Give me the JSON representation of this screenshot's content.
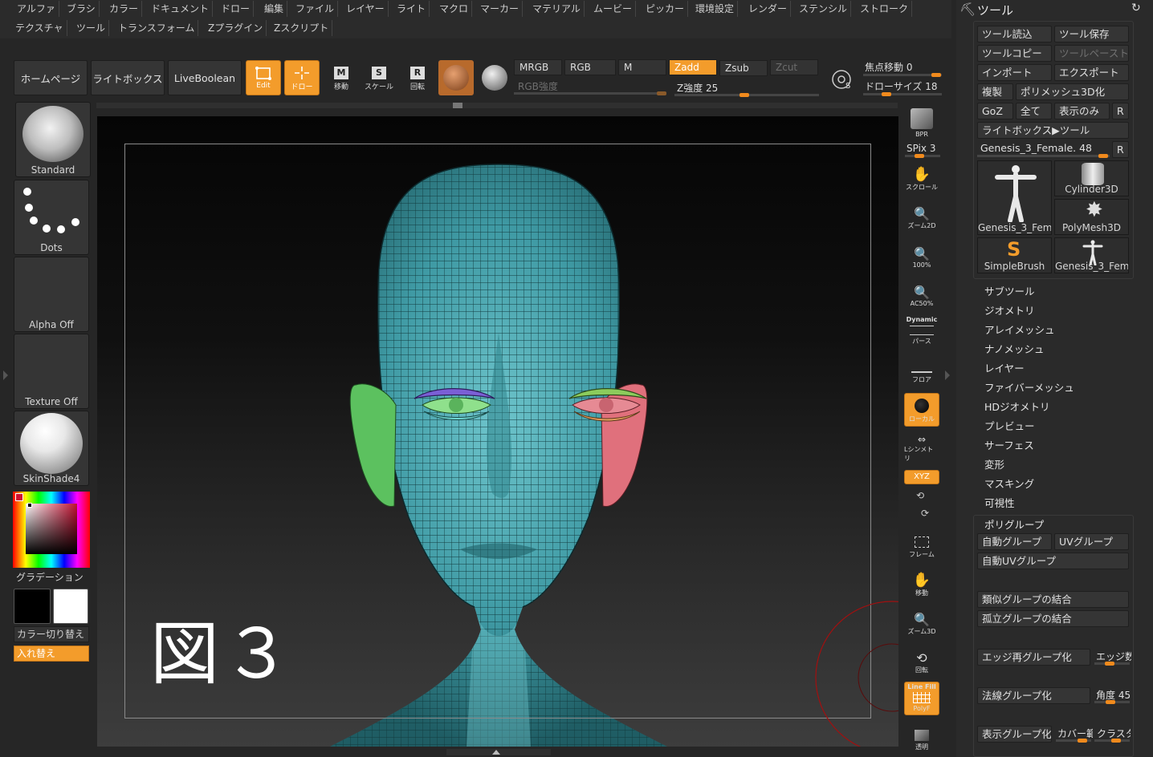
{
  "menu_row1": [
    "アルファ",
    "ブラシ",
    "カラー",
    "ドキュメント",
    "ドロー",
    "編集",
    "ファイル",
    "レイヤー",
    "ライト",
    "マクロ",
    "マーカー",
    "マテリアル",
    "ムービー",
    "ピッカー",
    "環境設定",
    "レンダー",
    "ステンシル",
    "ストローク"
  ],
  "menu_row2": [
    "テクスチャ",
    "ツール",
    "トランスフォーム",
    "Zプラグイン",
    "Zスクリプト"
  ],
  "toolbar": {
    "homepage": "ホームページ",
    "lightbox": "ライトボックス",
    "liveboolean": "LiveBoolean",
    "edit": "Edit",
    "draw": "ドロー",
    "move": "移動",
    "scale": "スケール",
    "rotate": "回転",
    "mrgb": "MRGB",
    "rgb": "RGB",
    "m": "M",
    "zadd": "Zadd",
    "zsub": "Zsub",
    "zcut": "Zcut",
    "rgb_intensity": "RGB強度",
    "z_intensity": "Z強度 25",
    "focal_shift": "焦点移動 0",
    "draw_size": "ドローサイズ 18"
  },
  "left_panel": {
    "brush": "Standard",
    "stroke": "Dots",
    "alpha": "Alpha Off",
    "texture": "Texture Off",
    "material": "SkinShade4",
    "gradient": "グラデーション",
    "color_switch": "カラー切り替え",
    "swap": "入れ替え"
  },
  "canvas": {
    "figure_label": "図３"
  },
  "right_shelf": {
    "bpr": "BPR",
    "spix": "SPix 3",
    "scroll": "スクロール",
    "zoom2d": "ズーム2D",
    "actual": "100%",
    "aahalf": "AC50%",
    "dynamic": "Dynamic",
    "persp": "パース",
    "floor": "フロア",
    "local": "ローカル",
    "sym": "Lシンメトリ",
    "xyz": "XYZ",
    "frame": "フレーム",
    "move": "移動",
    "zoom3d": "ズーム3D",
    "rotate": "回転",
    "linefill": "Line Fill",
    "polyf": "PolyF",
    "transp": "透明"
  },
  "tool_panel": {
    "title": "ツール",
    "load": "ツール読込",
    "save": "ツール保存",
    "copy": "ツールコピー",
    "paste": "ツールペースト",
    "import": "インポート",
    "export": "エクスポート",
    "clone": "複製",
    "make_poly": "ポリメッシュ3D化",
    "goz": "GoZ",
    "all": "全て",
    "visible": "表示のみ",
    "r": "R",
    "lightbox_tool": "ライトボックス▶ツール",
    "current_tool": "Genesis_3_Female. 48",
    "thumbs": [
      "Genesis_3_Fema",
      "Cylinder3D",
      "PolyMesh3D",
      "SimpleBrush",
      "Genesis_3_Fema"
    ],
    "sublist": [
      "サブツール",
      "ジオメトリ",
      "アレイメッシュ",
      "ナノメッシュ",
      "レイヤー",
      "ファイバーメッシュ",
      "HDジオメトリ",
      "プレビュー",
      "サーフェス",
      "変形",
      "マスキング",
      "可視性"
    ],
    "polygroups": {
      "title": "ポリグループ",
      "auto_groups": "自動グループ",
      "uv_groups": "UVグループ",
      "auto_uv": "自動UVグループ",
      "merge_similar": "類似グループの結合",
      "merge_stray": "孤立グループの結合",
      "edge_regroup": "エッジ再グループ化",
      "edge": "エッジ数",
      "normal_group": "法線グループ化",
      "angle": "角度 45",
      "visible_group": "表示グループ化",
      "coverage": "カバー範",
      "cluster": "クラスタ"
    }
  }
}
